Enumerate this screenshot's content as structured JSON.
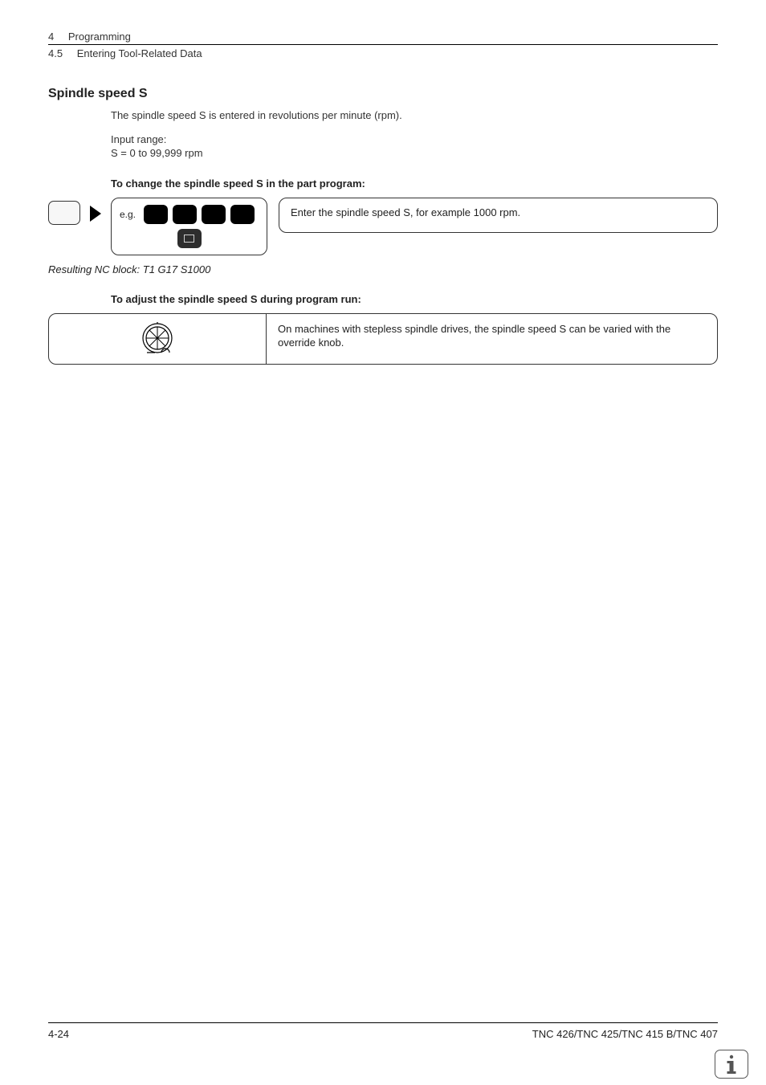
{
  "chapter": {
    "num": "4",
    "title": "Programming"
  },
  "section": {
    "num": "4.5",
    "title": "Entering Tool-Related Data"
  },
  "heading": "Spindle speed S",
  "intro": "The spindle speed S is entered in revolutions per minute (rpm).",
  "range_label": "Input range:",
  "range_value": "S = 0 to 99,999 rpm",
  "change_heading": "To change the spindle speed S in the part program:",
  "eg_label": "e.g.",
  "enter_desc": "Enter the spindle speed S, for example 1000 rpm.",
  "resulting": "Resulting NC block: T1 G17 S1000",
  "adjust_heading": "To adjust the spindle speed S during program run:",
  "override_desc": "On machines with stepless spindle drives, the spindle speed S can be varied with the override knob.",
  "footer": {
    "page": "4-24",
    "product": "TNC 426/TNC 425/TNC 415 B/TNC 407"
  },
  "icons": {
    "blank_key": "blank-key",
    "cursor_right": "cursor-right",
    "numeric_key": "numeric-key",
    "end_key": "end-key",
    "override_knob": "override-knob",
    "info": "info"
  }
}
